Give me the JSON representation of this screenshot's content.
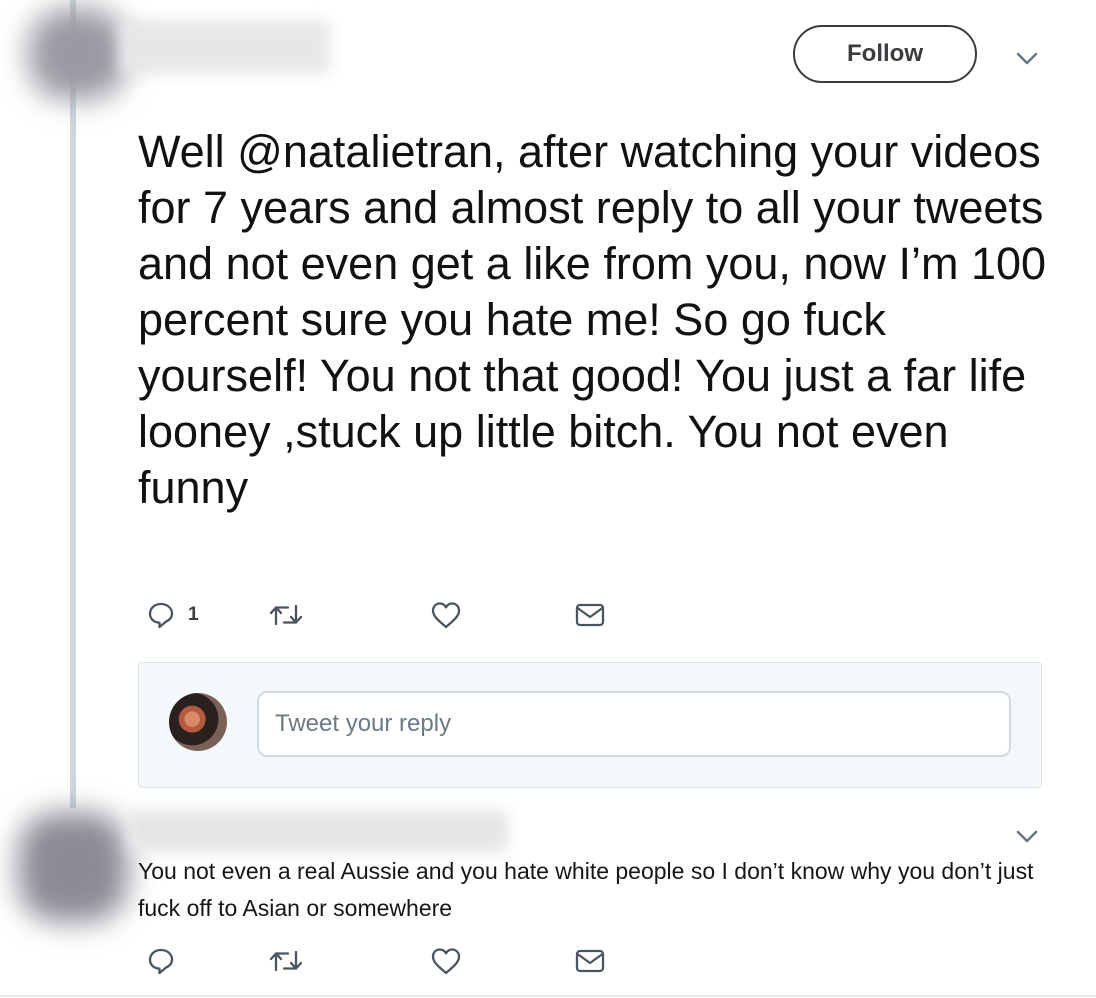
{
  "main_tweet": {
    "follow_label": "Follow",
    "text": "Well @natalietran, after watching your videos for 7 years and almost reply to all your tweets and not even get a like from you, now I’m 100 percent sure you hate me! So go fuck yourself! You not that good! You just a far life looney ,stuck up little bitch. You not even funny",
    "reply_count": "1"
  },
  "reply_composer": {
    "placeholder": "Tweet your reply"
  },
  "reply_tweet": {
    "text": "You not even a real Aussie and you hate white people so I don’t know why you don’t just fuck off to Asian or somewhere"
  },
  "icons": {
    "reply": "reply-icon",
    "retweet": "retweet-icon",
    "like": "heart-icon",
    "message": "envelope-icon",
    "menu": "chevron-down-icon"
  }
}
